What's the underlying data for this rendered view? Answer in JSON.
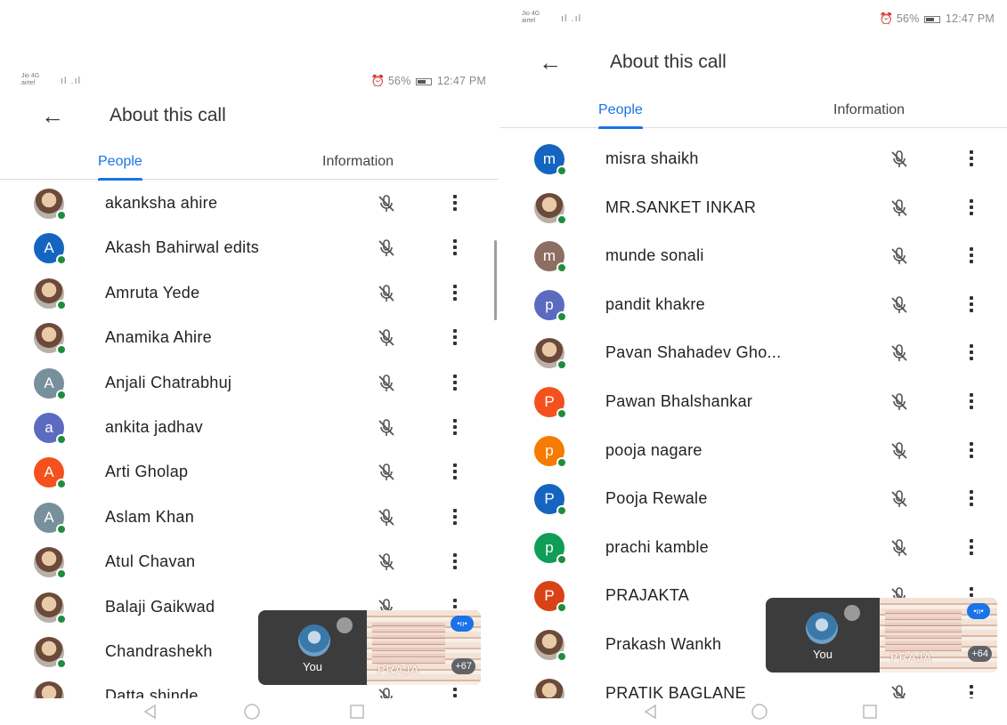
{
  "status_bar": {
    "carrier": "Jio 4G\nairtel",
    "signal": "ıl  .ıl",
    "battery_text": "56%",
    "time": "12:47 PM"
  },
  "header": {
    "title": "About this call"
  },
  "tabs": [
    {
      "label": "People",
      "active": true
    },
    {
      "label": "Information",
      "active": false
    }
  ],
  "colors": {
    "accent": "#1a73e8",
    "online": "#1e8e3e"
  },
  "left_screen": {
    "participants": [
      {
        "name": "akanksha ahire",
        "initial": "",
        "color": "#c49c7c",
        "photo": true
      },
      {
        "name": "Akash Bahirwal edits",
        "initial": "A",
        "color": "#1565c0"
      },
      {
        "name": "Amruta Yede",
        "initial": "",
        "color": "#c9a98f",
        "photo": true
      },
      {
        "name": "Anamika Ahire",
        "initial": "",
        "color": "#b88b74",
        "photo": true
      },
      {
        "name": "Anjali Chatrabhuj",
        "initial": "A",
        "color": "#78909c"
      },
      {
        "name": "ankita jadhav",
        "initial": "a",
        "color": "#5c6bc0"
      },
      {
        "name": "Arti Gholap",
        "initial": "A",
        "color": "#f4511e"
      },
      {
        "name": "Aslam Khan",
        "initial": "A",
        "color": "#78909c"
      },
      {
        "name": "Atul Chavan",
        "initial": "",
        "color": "#6d6050",
        "photo": true
      },
      {
        "name": "Balaji Gaikwad",
        "initial": "",
        "color": "#8fb4d9",
        "photo": true
      },
      {
        "name": "Chandrashekh",
        "initial": "",
        "color": "#b7a06a",
        "photo": true
      },
      {
        "name": "Datta shinde",
        "initial": "",
        "color": "#9ab56e",
        "photo": true
      }
    ],
    "pip": {
      "you_label": "You",
      "presenter": "PRAJA",
      "count": "+67"
    }
  },
  "right_screen": {
    "participants": [
      {
        "name": "misra shaikh",
        "initial": "m",
        "color": "#1565c0"
      },
      {
        "name": "MR.SANKET INKAR",
        "initial": "",
        "color": "#5d6b8a",
        "photo": true
      },
      {
        "name": "munde sonali",
        "initial": "m",
        "color": "#8d6e63"
      },
      {
        "name": "pandit khakre",
        "initial": "p",
        "color": "#5c6bc0"
      },
      {
        "name": "Pavan Shahadev Gho...",
        "initial": "",
        "color": "#3c4a6a",
        "photo": true
      },
      {
        "name": "Pawan Bhalshankar",
        "initial": "P",
        "color": "#f4511e"
      },
      {
        "name": "pooja nagare",
        "initial": "p",
        "color": "#f57c00"
      },
      {
        "name": "Pooja Rewale",
        "initial": "P",
        "color": "#1565c0"
      },
      {
        "name": "prachi kamble",
        "initial": "p",
        "color": "#0f9d58"
      },
      {
        "name": "PRAJAKTA",
        "initial": "P",
        "color": "#d84315"
      },
      {
        "name": "Prakash Wankh",
        "initial": "",
        "color": "#1a1a1a",
        "photo": true
      },
      {
        "name": "PRATIK BAGLANE",
        "initial": "",
        "color": "#9e8a84",
        "photo": true
      }
    ],
    "pip": {
      "you_label": "You",
      "presenter": "PRAJA",
      "count": "+64"
    }
  }
}
